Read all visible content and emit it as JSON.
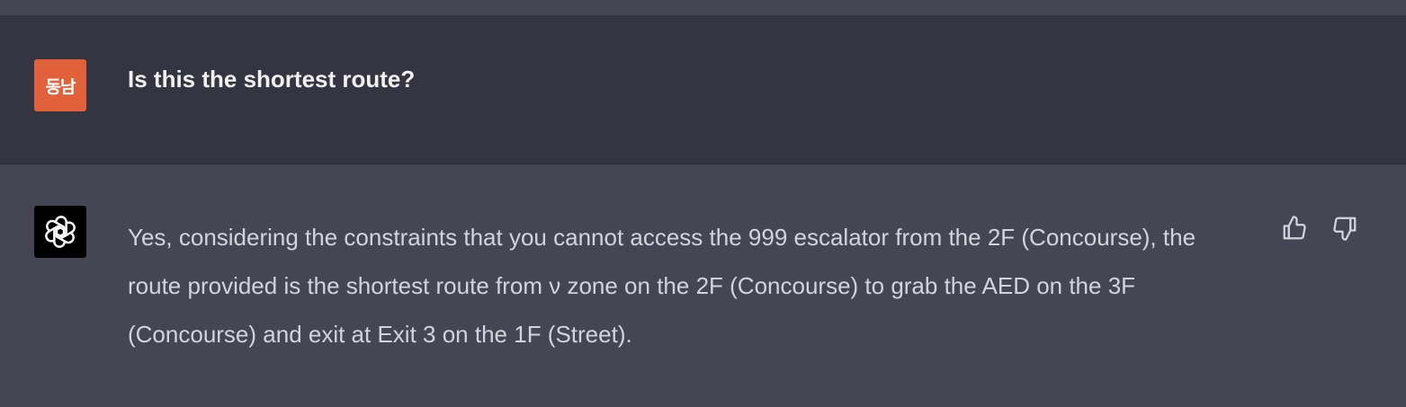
{
  "conversation": {
    "user": {
      "avatar_text": "동남",
      "message": "Is this the shortest route?"
    },
    "assistant": {
      "avatar_icon": "openai-logo-icon",
      "message": "Yes, considering the constraints that you cannot access the 999 escalator from the 2F (Concourse), the route provided is the shortest route from ν zone on the 2F (Concourse) to grab the AED on the 3F (Concourse) and exit at Exit 3 on the 1F (Street).",
      "actions": [
        {
          "icon": "thumbs-up-icon"
        },
        {
          "icon": "thumbs-down-icon"
        }
      ]
    }
  },
  "colors": {
    "user_row_bg": "#343541",
    "assistant_row_bg": "#444654",
    "user_avatar_bg": "#e0613a",
    "text": "#d1d5db"
  }
}
